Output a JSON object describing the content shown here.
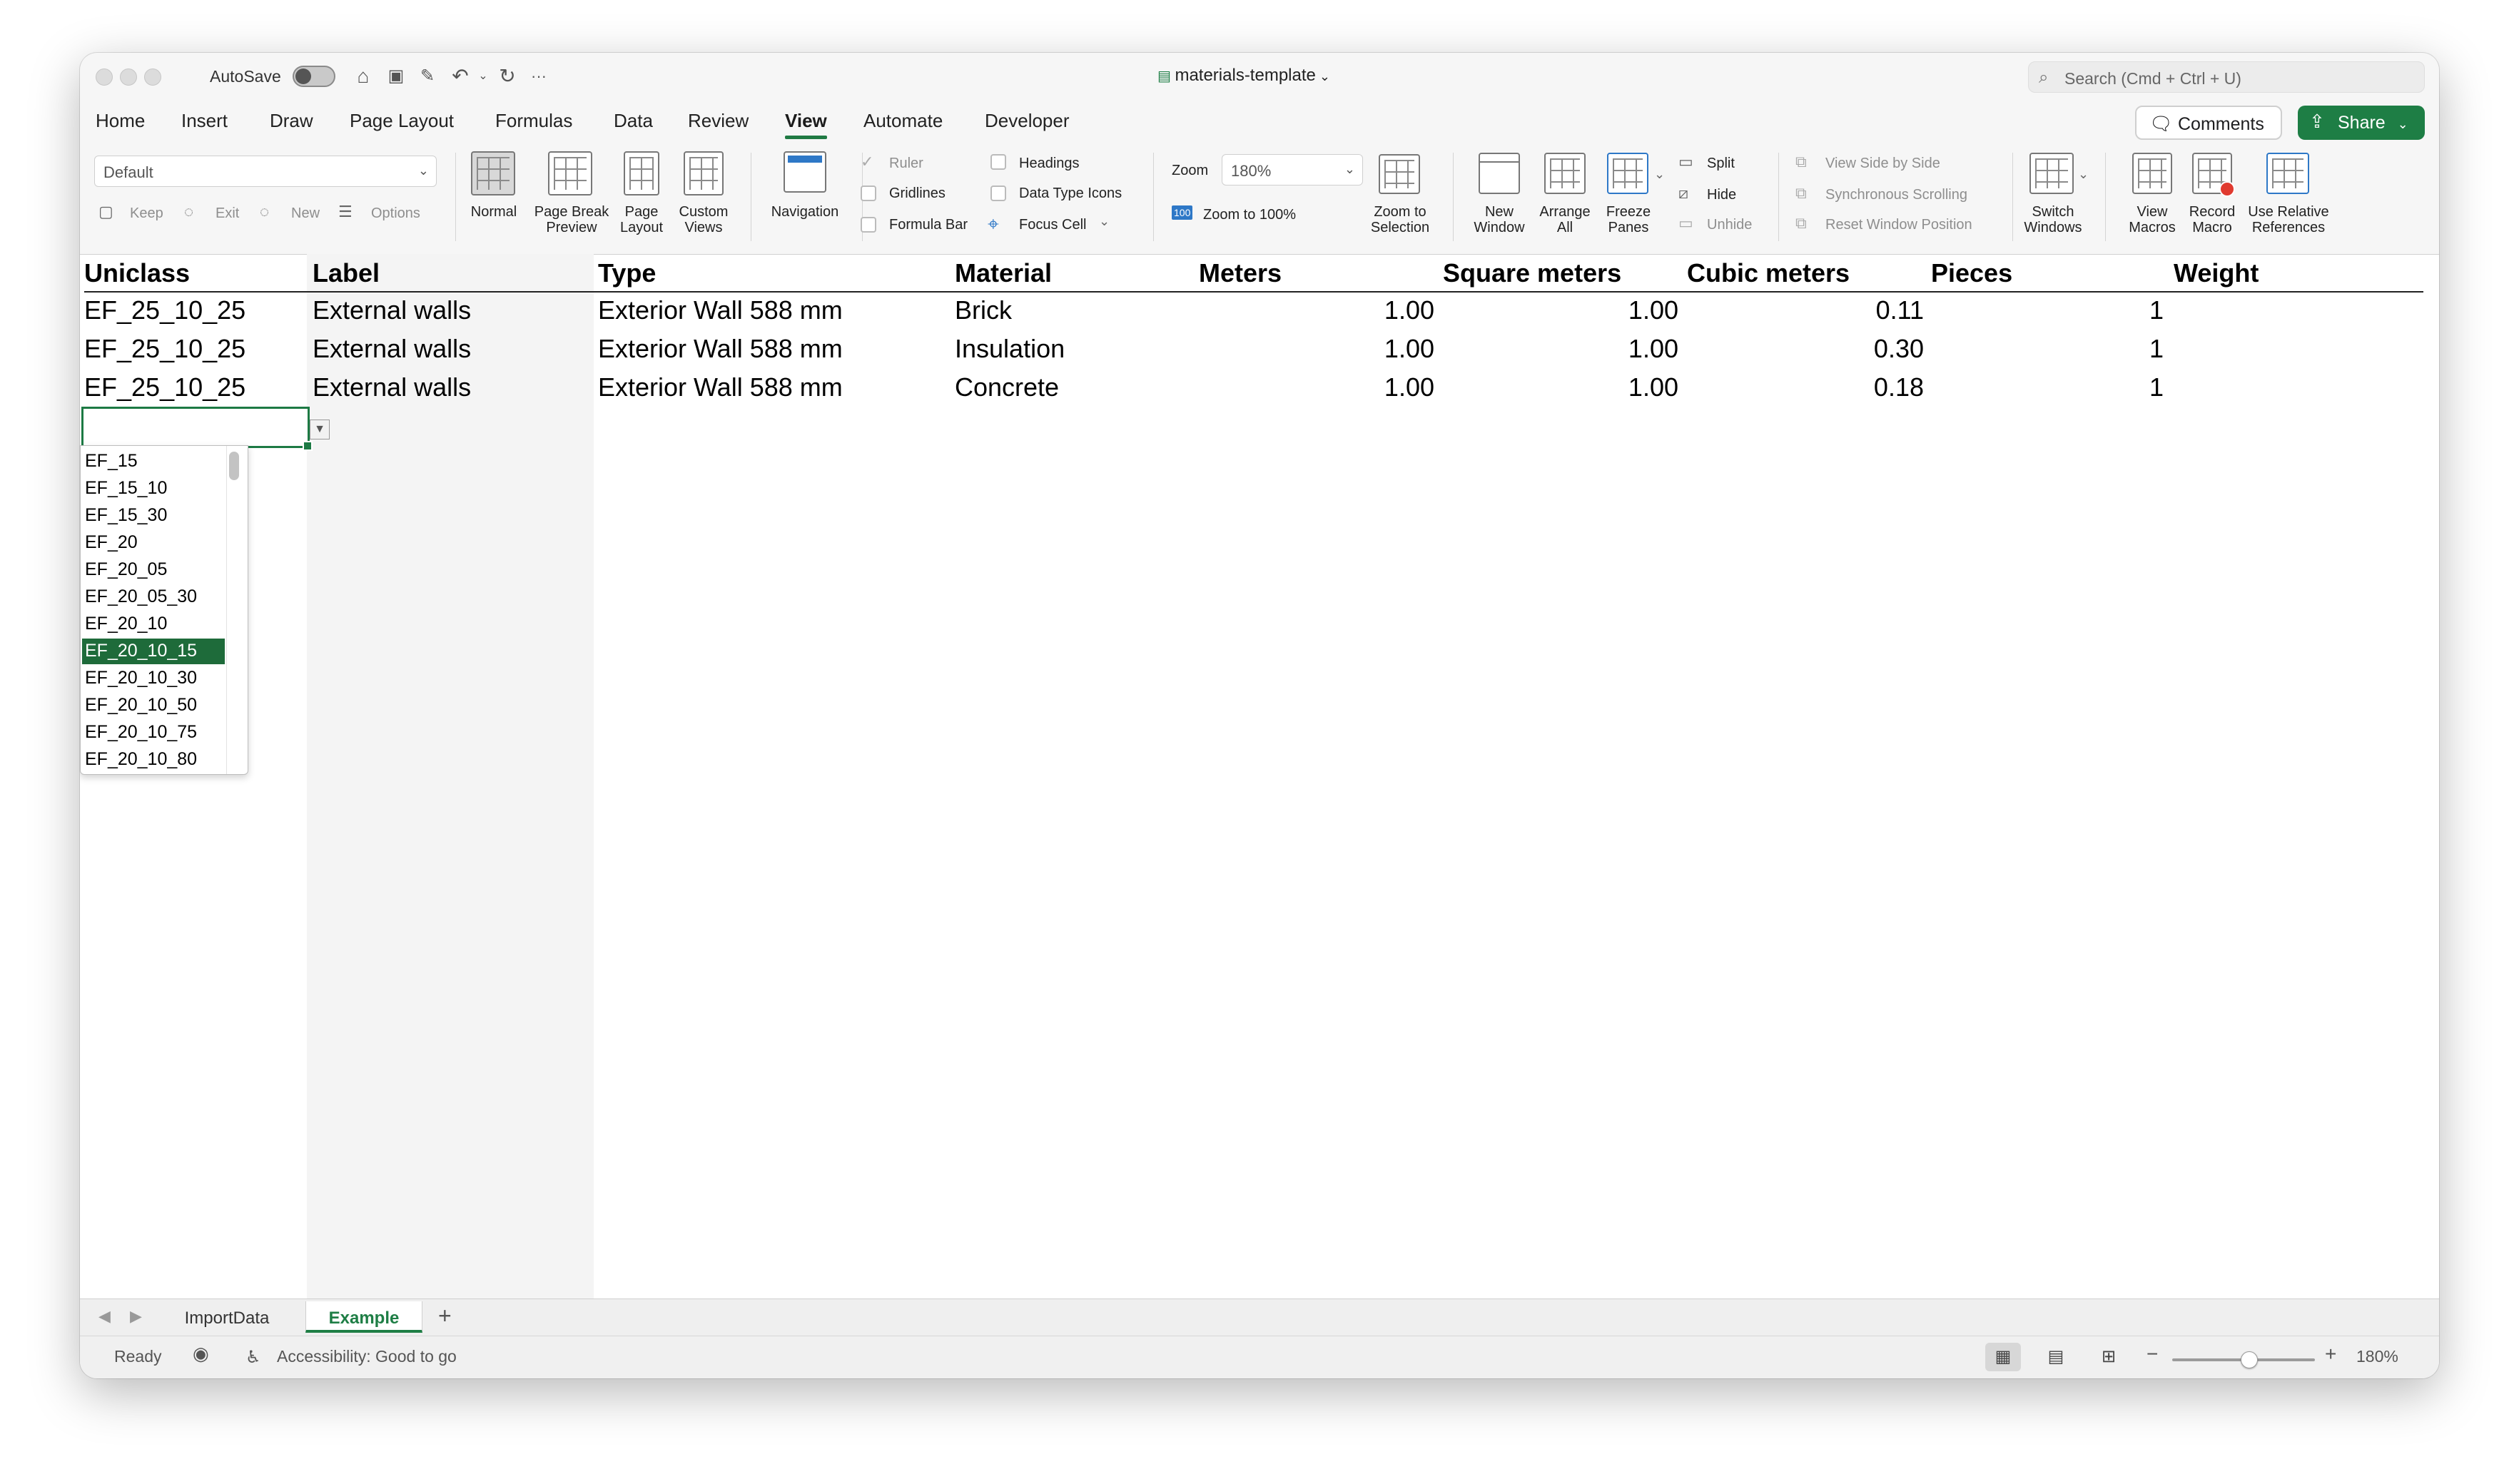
{
  "titlebar": {
    "autosave_label": "AutoSave",
    "document_title": "materials-template",
    "search_placeholder": "Search (Cmd + Ctrl + U)"
  },
  "tabs": [
    "Home",
    "Insert",
    "Draw",
    "Page Layout",
    "Formulas",
    "Data",
    "Review",
    "View",
    "Automate",
    "Developer"
  ],
  "active_tab": "View",
  "actions": {
    "comments": "Comments",
    "share": "Share"
  },
  "ribbon": {
    "sheet_view_select": "Default",
    "sheet_view_keep": "Keep",
    "sheet_view_exit": "Exit",
    "sheet_view_new": "New",
    "sheet_view_options": "Options",
    "normal": "Normal",
    "page_break_preview": [
      "Page Break",
      "Preview"
    ],
    "page_layout": [
      "Page",
      "Layout"
    ],
    "custom_views": [
      "Custom",
      "Views"
    ],
    "navigation": "Navigation",
    "ruler": "Ruler",
    "gridlines": "Gridlines",
    "formula_bar": "Formula Bar",
    "headings": "Headings",
    "data_type_icons": "Data Type Icons",
    "focus_cell": "Focus Cell",
    "zoom_label": "Zoom",
    "zoom_value": "180%",
    "zoom_to_100": "Zoom to 100%",
    "zoom_to_selection": [
      "Zoom to",
      "Selection"
    ],
    "new_window": [
      "New",
      "Window"
    ],
    "arrange_all": [
      "Arrange",
      "All"
    ],
    "freeze_panes": [
      "Freeze",
      "Panes"
    ],
    "split": "Split",
    "hide": "Hide",
    "unhide": "Unhide",
    "view_side_by_side": "View Side by Side",
    "synchronous_scrolling": "Synchronous Scrolling",
    "reset_window_position": "Reset Window Position",
    "switch_windows": [
      "Switch",
      "Windows"
    ],
    "view_macros": [
      "View",
      "Macros"
    ],
    "record_macro": [
      "Record",
      "Macro"
    ],
    "use_relative_references": [
      "Use Relative",
      "References"
    ]
  },
  "sheet": {
    "headers": [
      "Uniclass",
      "Label",
      "Type",
      "Material",
      "Meters",
      "Square meters",
      "Cubic meters",
      "Pieces",
      "Weight"
    ],
    "rows": [
      [
        "EF_25_10_25",
        "External walls",
        "Exterior Wall 588 mm",
        "Brick",
        "1.00",
        "1.00",
        "0.11",
        "1"
      ],
      [
        "EF_25_10_25",
        "External walls",
        "Exterior Wall 588 mm",
        "Insulation",
        "1.00",
        "1.00",
        "0.30",
        "1"
      ],
      [
        "EF_25_10_25",
        "External walls",
        "Exterior Wall 588 mm",
        "Concrete",
        "1.00",
        "1.00",
        "0.18",
        "1"
      ]
    ],
    "validation_list": [
      "EF_15",
      "EF_15_10",
      "EF_15_30",
      "EF_20",
      "EF_20_05",
      "EF_20_05_30",
      "EF_20_10",
      "EF_20_10_15",
      "EF_20_10_30",
      "EF_20_10_50",
      "EF_20_10_75",
      "EF_20_10_80"
    ],
    "validation_selected": "EF_20_10_15"
  },
  "sheet_tabs": [
    "ImportData",
    "Example"
  ],
  "active_sheet": "Example",
  "status": {
    "ready": "Ready",
    "accessibility": "Accessibility: Good to go",
    "zoom": "180%"
  },
  "colors": {
    "accent": "#1e7e45",
    "selection": "#1e6b3a"
  }
}
